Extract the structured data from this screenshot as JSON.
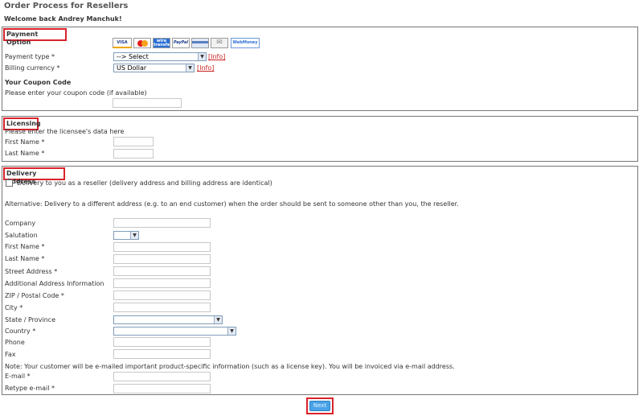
{
  "page": {
    "title": "Order Process for Resellers",
    "welcome": "Welcome back Andrey Manchuk!"
  },
  "payment": {
    "heading": "Payment Option",
    "cards": [
      {
        "name": "visa-icon",
        "label": "VISA",
        "color": "#1a3b8f"
      },
      {
        "name": "mastercard-icon",
        "label": "MC",
        "color": "#d83a1c"
      },
      {
        "name": "wire-transfer-icon",
        "label": "wire transfer",
        "color": "#2a6fd6"
      },
      {
        "name": "paypal-icon",
        "label": "PayPal",
        "color": "#1e3f8a"
      },
      {
        "name": "card-generic-icon",
        "label": "",
        "color": "#5a7fbf"
      },
      {
        "name": "envelope-icon",
        "label": "",
        "color": "#888888"
      },
      {
        "name": "webmoney-icon",
        "label": "WebMoney",
        "color": "#2a6fd6"
      }
    ],
    "payment_type_label": "Payment type *",
    "payment_type_value": "--> Select",
    "billing_currency_label": "Billing currency *",
    "billing_currency_value": "US Dollar",
    "info_link": "[Info]",
    "coupon_heading": "Your Coupon Code",
    "coupon_hint": "Please enter your coupon code (if available)"
  },
  "licensing": {
    "heading": "Licensing",
    "hint": "Please enter the licensee's data here",
    "first_name_label": "First Name *",
    "last_name_label": "Last Name *"
  },
  "delivery": {
    "heading": "Delivery Address",
    "reseller_checkbox_label": "Delivery to you as a reseller (delivery address and billing address are identical)",
    "alternative_text": "Alternative: Delivery to a different address (e.g. to an end customer) when the order should be sent to someone other than you, the reseller.",
    "company_label": "Company",
    "salutation_label": "Salutation",
    "first_name_label": "First Name *",
    "last_name_label": "Last Name *",
    "street_label": "Street Address *",
    "additional_label": "Additional Address Information",
    "zip_label": "ZIP / Postal Code *",
    "city_label": "City *",
    "state_label": "State / Province",
    "country_label": "Country *",
    "phone_label": "Phone",
    "fax_label": "Fax",
    "note": "Note: Your customer will be e-mailed important product-specific information (such as a license key). You will be invoiced via e-mail address.",
    "email_label": "E-mail *",
    "retype_email_label": "Retype e-mail *"
  },
  "actions": {
    "next_label": "Next"
  }
}
